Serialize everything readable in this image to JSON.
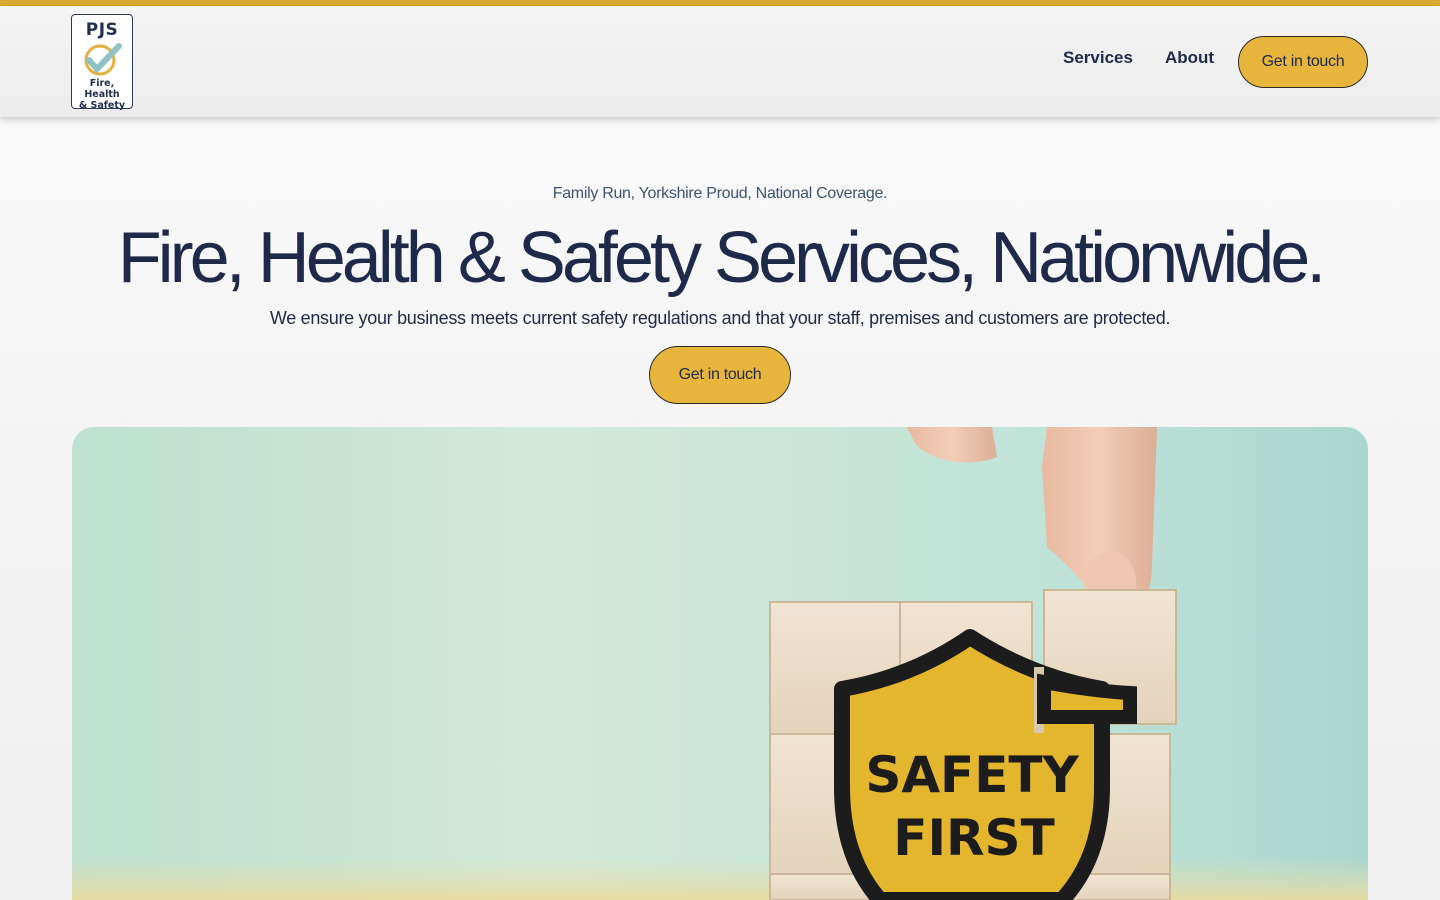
{
  "brand": {
    "logo_title": "PJS",
    "logo_subtitle_line1": "Fire, Health",
    "logo_subtitle_line2": "& Safety",
    "accent_color": "#e7b53b",
    "top_bar_color": "#d9a92b",
    "text_color": "#1f2a4a"
  },
  "nav": {
    "links": [
      {
        "label": "Services"
      },
      {
        "label": "About"
      }
    ],
    "cta_label": "Get in touch"
  },
  "hero": {
    "tagline": "Family Run, Yorkshire Proud, National Coverage.",
    "headline": "Fire, Health & Safety Services, Nationwide.",
    "subtext": "We ensure your business meets current safety regulations and that your staff, premises and customers are protected.",
    "cta_label": "Get in touch",
    "image": {
      "line1": "SAFETY",
      "line2": "FIRST"
    }
  }
}
